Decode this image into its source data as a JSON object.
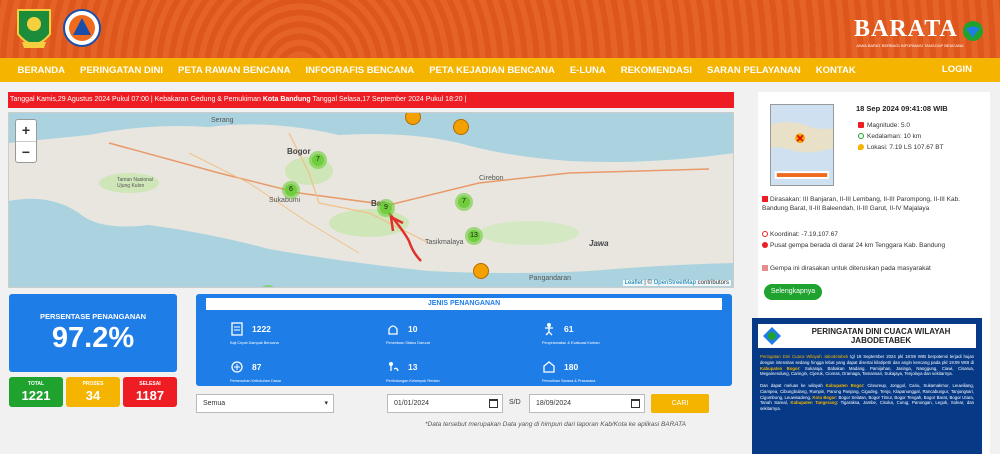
{
  "brand": {
    "name": "BARATA",
    "tagline": "JAWA BARAT BERBAGI INFORMASI TANGGAP BENCANA"
  },
  "nav": {
    "items": [
      "BERANDA",
      "PERINGATAN DINI",
      "PETA RAWAN BENCANA",
      "INFOGRAFIS BENCANA",
      "PETA KEJADIAN BENCANA",
      "E-LUNA",
      "REKOMENDASI",
      "SARAN PELAYANAN",
      "KONTAK"
    ],
    "login": "LOGIN"
  },
  "ticker": {
    "text_a": "Tanggal Kamis,29 Agustus 2024 Pukul 07:00 | Kebakaran Gedung & Pemukiman ",
    "highlight": "Kota Bandung",
    "text_b": " Tanggal Selasa,17 September 2024 Pukul 18:20 |"
  },
  "map": {
    "zoom_in": "+",
    "zoom_out": "−",
    "labels": {
      "serang": "Serang",
      "bogor": "Bogor",
      "sukabumi": "Sukabumi",
      "bandung": "Ban",
      "tasikmalaya": "Tasikmalaya",
      "cirebon": "Cirebon",
      "jawa": "Jawa",
      "taman": "Taman Nasional Ujung Kulon",
      "pangandaran": "Pangandaran"
    },
    "clusters": [
      "7",
      "6",
      "9",
      "7",
      "13"
    ],
    "attribution": {
      "leaflet": "Leaflet",
      "sep": " | © ",
      "osm": "OpenStreetMap",
      "rest": " contributors"
    }
  },
  "summary": {
    "label": "PERSENTASE PENANGANAN",
    "value": "97.2%",
    "stats": [
      {
        "label": "TOTAL",
        "value": "1221",
        "color": "#1fa22e"
      },
      {
        "label": "PROSES",
        "value": "34",
        "color": "#f4b400"
      },
      {
        "label": "SELESAI",
        "value": "1187",
        "color": "#ee1d23"
      }
    ]
  },
  "jenis": {
    "title": "JENIS PENANGANAN",
    "items": [
      {
        "value": "1222",
        "label": "Kaji Cepat Dampak Bencana"
      },
      {
        "value": "10",
        "label": "Penentuan Status Darurat"
      },
      {
        "value": "61",
        "label": "Penyelamatan & Evakuasi Korban"
      },
      {
        "value": "87",
        "label": "Pemenuhan Kebutuhan Dasar"
      },
      {
        "value": "13",
        "label": "Perlindungan Kelompok Rentan"
      },
      {
        "value": "180",
        "label": "Pemulihan Sarana & Prasarana"
      }
    ]
  },
  "filter": {
    "select_value": "Semua",
    "date_from": "01/01/2024",
    "sd": "S/D",
    "date_to": "18/09/2024",
    "search": "CARI",
    "note": "*Data tersebut merupakan Data yang di himpun dari laporan Kab/Kota ke aplikasi BARATA"
  },
  "earthquake": {
    "time": "18 Sep 2024 09:41:08 WIB",
    "magnitude": "Magnitude: 5.0",
    "depth": "Kedalaman: 10 km",
    "location": "Lokasi: 7.19 LS 107.67 BT",
    "felt": "Dirasakan: III Banjaran, II-III Lembang, II-III Parompong, II-III Kab. Bandung Barat, II-III Baleendah, II-III Garut, II-IV Majalaya",
    "coord": "Koordinat: -7.19,107.67",
    "center": "Pusat gempa berada di darat 24 km Tenggara Kab. Bandung",
    "note": "Gempa ini dirasakan untuk diteruskan pada masyarakat",
    "button": "Selengkapnya"
  },
  "weather": {
    "title": "PERINGATAN DINI CUACA WILAYAH JABODETABEK",
    "p1_a": "Peringatan Dini Cuaca Wilayah Jabodetabek",
    "p1_b": " tgl 18 September 2024 pkl 18:59 WIB berpotensi terjadi hujan dengan intensitas sedang hingga lebat yang dapat disertai kilat/petir dan angin kencang pada pkl 19:09 WIB di ",
    "p1_c": "Kabupaten Bogor",
    "p1_d": ": Sukaraja, Babakan Madang, Pamijahan, Jasinga, Nanggung, Ciawi, Cisarua, Megamendung, Caringin, Cijeruk, Ciomas, Dramaga, Tamansari, Sukajaya, Tenjolaya dan sekitarnya.",
    "p2_a": "Dan dapat meluas ke wilayah ",
    "p2_b": "Kabupaten Bogor",
    "p2_c": ": Citeureup, Jonggol, Cariu, Sukamakmur, Leuwiliang, Ciampea, Cibungbulang, Rumpin, Parung Panjang, Cigudeg, Tenjo, Klapanunggal, Rancabungur, Tanjungsari, Cigombong, Leuwisadeng, ",
    "p2_d": "Kota Bogor",
    "p2_e": ": Bogor Selatan, Bogor Timur, Bogor Tengah, Bogor Barat, Bogor Utara, Tanah Sareal, ",
    "p2_f": "Kabupaten Tangerang",
    "p2_g": ": Tigaraksa, Jambe, Cisoka, Curug, Panongan, Legok, Solear, dan sekitarnya."
  }
}
